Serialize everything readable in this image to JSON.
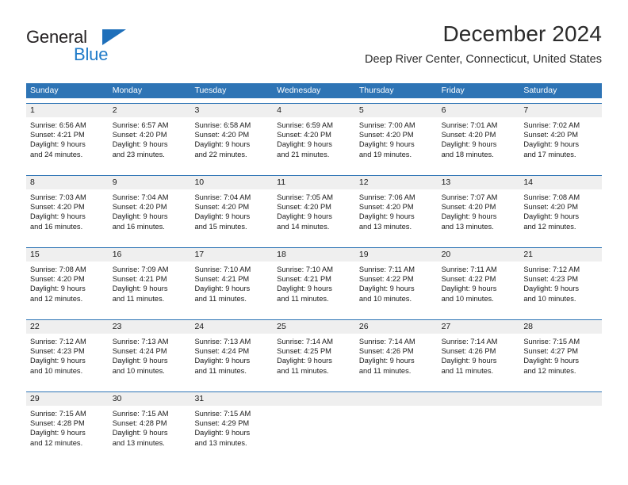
{
  "logo": {
    "text_top": "General",
    "text_bottom": "Blue",
    "triangle_icon": "blue-triangle-icon",
    "color_dark": "#231f20",
    "color_blue": "#1e7ac8"
  },
  "header": {
    "title": "December 2024",
    "subtitle": "Deep River Center, Connecticut, United States"
  },
  "theme": {
    "header_blue": "#2e74b5",
    "daynum_gray": "#efefef",
    "text": "#1a1a1a",
    "page_bg": "#ffffff"
  },
  "weekdays": [
    "Sunday",
    "Monday",
    "Tuesday",
    "Wednesday",
    "Thursday",
    "Friday",
    "Saturday"
  ],
  "weeks": [
    {
      "days": [
        {
          "num": "1",
          "sunrise": "Sunrise: 6:56 AM",
          "sunset": "Sunset: 4:21 PM",
          "daylight1": "Daylight: 9 hours",
          "daylight2": "and 24 minutes."
        },
        {
          "num": "2",
          "sunrise": "Sunrise: 6:57 AM",
          "sunset": "Sunset: 4:20 PM",
          "daylight1": "Daylight: 9 hours",
          "daylight2": "and 23 minutes."
        },
        {
          "num": "3",
          "sunrise": "Sunrise: 6:58 AM",
          "sunset": "Sunset: 4:20 PM",
          "daylight1": "Daylight: 9 hours",
          "daylight2": "and 22 minutes."
        },
        {
          "num": "4",
          "sunrise": "Sunrise: 6:59 AM",
          "sunset": "Sunset: 4:20 PM",
          "daylight1": "Daylight: 9 hours",
          "daylight2": "and 21 minutes."
        },
        {
          "num": "5",
          "sunrise": "Sunrise: 7:00 AM",
          "sunset": "Sunset: 4:20 PM",
          "daylight1": "Daylight: 9 hours",
          "daylight2": "and 19 minutes."
        },
        {
          "num": "6",
          "sunrise": "Sunrise: 7:01 AM",
          "sunset": "Sunset: 4:20 PM",
          "daylight1": "Daylight: 9 hours",
          "daylight2": "and 18 minutes."
        },
        {
          "num": "7",
          "sunrise": "Sunrise: 7:02 AM",
          "sunset": "Sunset: 4:20 PM",
          "daylight1": "Daylight: 9 hours",
          "daylight2": "and 17 minutes."
        }
      ]
    },
    {
      "days": [
        {
          "num": "8",
          "sunrise": "Sunrise: 7:03 AM",
          "sunset": "Sunset: 4:20 PM",
          "daylight1": "Daylight: 9 hours",
          "daylight2": "and 16 minutes."
        },
        {
          "num": "9",
          "sunrise": "Sunrise: 7:04 AM",
          "sunset": "Sunset: 4:20 PM",
          "daylight1": "Daylight: 9 hours",
          "daylight2": "and 16 minutes."
        },
        {
          "num": "10",
          "sunrise": "Sunrise: 7:04 AM",
          "sunset": "Sunset: 4:20 PM",
          "daylight1": "Daylight: 9 hours",
          "daylight2": "and 15 minutes."
        },
        {
          "num": "11",
          "sunrise": "Sunrise: 7:05 AM",
          "sunset": "Sunset: 4:20 PM",
          "daylight1": "Daylight: 9 hours",
          "daylight2": "and 14 minutes."
        },
        {
          "num": "12",
          "sunrise": "Sunrise: 7:06 AM",
          "sunset": "Sunset: 4:20 PM",
          "daylight1": "Daylight: 9 hours",
          "daylight2": "and 13 minutes."
        },
        {
          "num": "13",
          "sunrise": "Sunrise: 7:07 AM",
          "sunset": "Sunset: 4:20 PM",
          "daylight1": "Daylight: 9 hours",
          "daylight2": "and 13 minutes."
        },
        {
          "num": "14",
          "sunrise": "Sunrise: 7:08 AM",
          "sunset": "Sunset: 4:20 PM",
          "daylight1": "Daylight: 9 hours",
          "daylight2": "and 12 minutes."
        }
      ]
    },
    {
      "days": [
        {
          "num": "15",
          "sunrise": "Sunrise: 7:08 AM",
          "sunset": "Sunset: 4:20 PM",
          "daylight1": "Daylight: 9 hours",
          "daylight2": "and 12 minutes."
        },
        {
          "num": "16",
          "sunrise": "Sunrise: 7:09 AM",
          "sunset": "Sunset: 4:21 PM",
          "daylight1": "Daylight: 9 hours",
          "daylight2": "and 11 minutes."
        },
        {
          "num": "17",
          "sunrise": "Sunrise: 7:10 AM",
          "sunset": "Sunset: 4:21 PM",
          "daylight1": "Daylight: 9 hours",
          "daylight2": "and 11 minutes."
        },
        {
          "num": "18",
          "sunrise": "Sunrise: 7:10 AM",
          "sunset": "Sunset: 4:21 PM",
          "daylight1": "Daylight: 9 hours",
          "daylight2": "and 11 minutes."
        },
        {
          "num": "19",
          "sunrise": "Sunrise: 7:11 AM",
          "sunset": "Sunset: 4:22 PM",
          "daylight1": "Daylight: 9 hours",
          "daylight2": "and 10 minutes."
        },
        {
          "num": "20",
          "sunrise": "Sunrise: 7:11 AM",
          "sunset": "Sunset: 4:22 PM",
          "daylight1": "Daylight: 9 hours",
          "daylight2": "and 10 minutes."
        },
        {
          "num": "21",
          "sunrise": "Sunrise: 7:12 AM",
          "sunset": "Sunset: 4:23 PM",
          "daylight1": "Daylight: 9 hours",
          "daylight2": "and 10 minutes."
        }
      ]
    },
    {
      "days": [
        {
          "num": "22",
          "sunrise": "Sunrise: 7:12 AM",
          "sunset": "Sunset: 4:23 PM",
          "daylight1": "Daylight: 9 hours",
          "daylight2": "and 10 minutes."
        },
        {
          "num": "23",
          "sunrise": "Sunrise: 7:13 AM",
          "sunset": "Sunset: 4:24 PM",
          "daylight1": "Daylight: 9 hours",
          "daylight2": "and 10 minutes."
        },
        {
          "num": "24",
          "sunrise": "Sunrise: 7:13 AM",
          "sunset": "Sunset: 4:24 PM",
          "daylight1": "Daylight: 9 hours",
          "daylight2": "and 11 minutes."
        },
        {
          "num": "25",
          "sunrise": "Sunrise: 7:14 AM",
          "sunset": "Sunset: 4:25 PM",
          "daylight1": "Daylight: 9 hours",
          "daylight2": "and 11 minutes."
        },
        {
          "num": "26",
          "sunrise": "Sunrise: 7:14 AM",
          "sunset": "Sunset: 4:26 PM",
          "daylight1": "Daylight: 9 hours",
          "daylight2": "and 11 minutes."
        },
        {
          "num": "27",
          "sunrise": "Sunrise: 7:14 AM",
          "sunset": "Sunset: 4:26 PM",
          "daylight1": "Daylight: 9 hours",
          "daylight2": "and 11 minutes."
        },
        {
          "num": "28",
          "sunrise": "Sunrise: 7:15 AM",
          "sunset": "Sunset: 4:27 PM",
          "daylight1": "Daylight: 9 hours",
          "daylight2": "and 12 minutes."
        }
      ]
    },
    {
      "days": [
        {
          "num": "29",
          "sunrise": "Sunrise: 7:15 AM",
          "sunset": "Sunset: 4:28 PM",
          "daylight1": "Daylight: 9 hours",
          "daylight2": "and 12 minutes."
        },
        {
          "num": "30",
          "sunrise": "Sunrise: 7:15 AM",
          "sunset": "Sunset: 4:28 PM",
          "daylight1": "Daylight: 9 hours",
          "daylight2": "and 13 minutes."
        },
        {
          "num": "31",
          "sunrise": "Sunrise: 7:15 AM",
          "sunset": "Sunset: 4:29 PM",
          "daylight1": "Daylight: 9 hours",
          "daylight2": "and 13 minutes."
        },
        {
          "num": "",
          "sunrise": "",
          "sunset": "",
          "daylight1": "",
          "daylight2": ""
        },
        {
          "num": "",
          "sunrise": "",
          "sunset": "",
          "daylight1": "",
          "daylight2": ""
        },
        {
          "num": "",
          "sunrise": "",
          "sunset": "",
          "daylight1": "",
          "daylight2": ""
        },
        {
          "num": "",
          "sunrise": "",
          "sunset": "",
          "daylight1": "",
          "daylight2": ""
        }
      ]
    }
  ]
}
